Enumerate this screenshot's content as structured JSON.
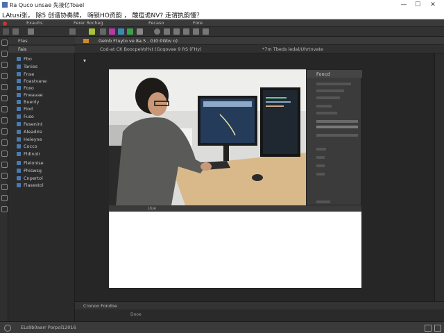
{
  "window": {
    "title": "Ra  Quco unsae  先接亿Toael",
    "minimize": "—",
    "maximize": "☐",
    "close": "✕"
  },
  "prompt": {
    "text": "LAtusi张，  除5 创谱协奏牌，  嗨锁HO资韵  ，  酸痘诡NV?  走谓执韵懂？"
  },
  "menubar": {
    "items": [
      "Exauhs",
      "Ferer  Rocheg",
      "Fecaso",
      "Fore"
    ]
  },
  "left_panel": {
    "header": "Ftes",
    "subheader": "Fais",
    "layers": [
      "Fbo",
      "Tanies",
      "Fnse",
      "Foastvane",
      "Foxo",
      "Fneavae",
      "Buenly",
      "Fiod",
      "Fuso",
      "Fesenint",
      "Aleadire",
      "Heleyne",
      "Cocco",
      "Fldinolr",
      "Flelonise",
      "Phiswsg",
      "Cnpertol",
      "Flasestol"
    ]
  },
  "doc_tabs": {
    "tab": "Gelnb  Ftuyto ve 8a.5 ,  G(0:0Gbv o)",
    "options": "Cod-at CK  BoocpeVol%t (Gcqovae 9 RS (FHy)",
    "options2": "*7m  Tbeds ledal/Uhrtnvate"
  },
  "float_panel": {
    "title": "Foncd"
  },
  "photo_strip": {
    "label": "Uue"
  },
  "timeline": {
    "label": "Cronoo  Fondoe",
    "sub": "Dooe"
  },
  "statusbar": {
    "text": "ELs9b0aarr  Porpol12016"
  },
  "colors": {
    "accent": "#d08a2a",
    "panel_bg": "#2a2a2a",
    "canvas_bg": "#262626",
    "layer_icon": "#4a7ab0"
  }
}
